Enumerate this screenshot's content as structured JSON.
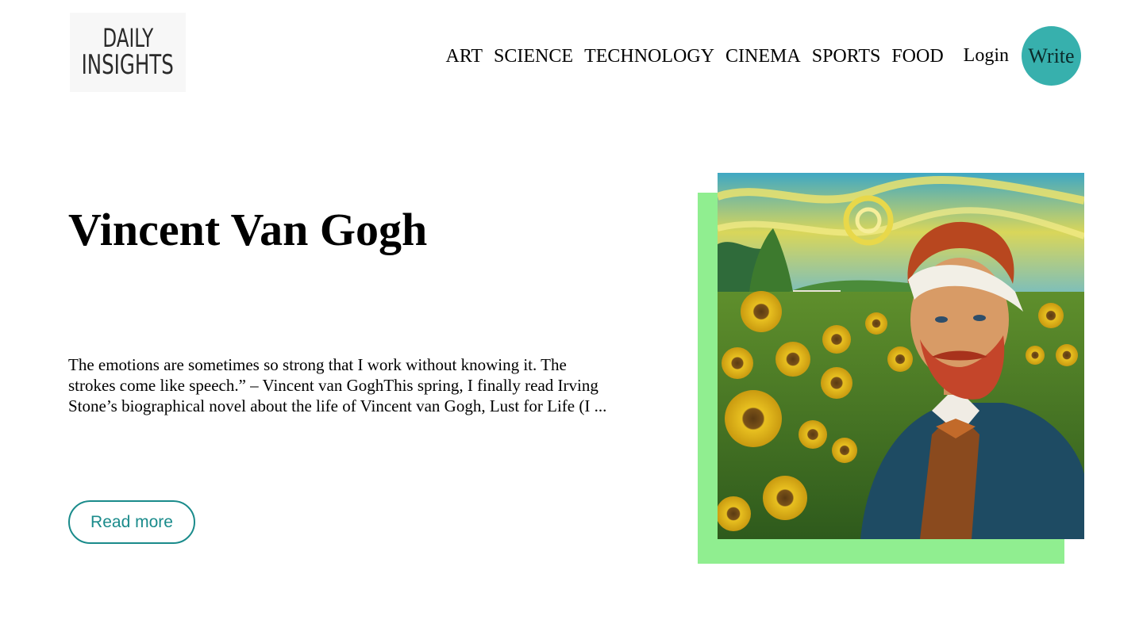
{
  "header": {
    "logo": {
      "line1": "DAILY",
      "line2": "INSIGHTS"
    },
    "nav": [
      {
        "label": "ART"
      },
      {
        "label": "SCIENCE"
      },
      {
        "label": "TECHNOLOGY"
      },
      {
        "label": "CINEMA"
      },
      {
        "label": "SPORTS"
      },
      {
        "label": "FOOD"
      }
    ],
    "login_label": "Login",
    "write_label": "Write"
  },
  "post": {
    "title": "Vincent Van Gogh",
    "excerpt": "The emotions are sometimes so strong that I work without knowing it. The strokes come like speech.” – Vincent van GoghThis spring, I finally read Irving Stone’s biographical novel about the life of Vincent van Gogh, Lust for Life (I ...",
    "read_more_label": "Read more",
    "image_icon": "van-gogh-portrait-painting"
  },
  "colors": {
    "accent_teal": "#37b0ad",
    "button_border": "#1a8b8b",
    "image_backdrop": "#90ee90"
  }
}
